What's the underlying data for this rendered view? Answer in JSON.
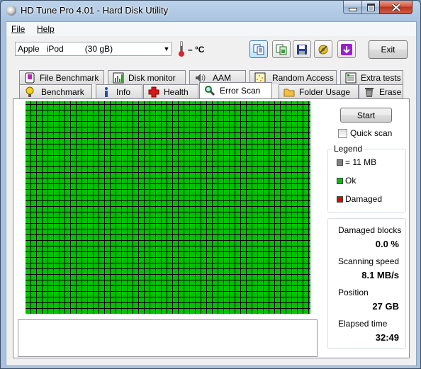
{
  "window": {
    "title": "HD Tune Pro 4.01 - Hard Disk Utility"
  },
  "menu": {
    "file_label": "File",
    "help_label": "Help"
  },
  "toolbar": {
    "device": "Apple   iPod         (30 gB)",
    "temperature": "– °C",
    "exit_label": "Exit",
    "buttons": [
      "copy-text-icon",
      "copy-screenshot-icon",
      "save-icon",
      "options-icon",
      "download-icon"
    ]
  },
  "tabs": {
    "row1": [
      {
        "label": "File Benchmark",
        "icon": "file-benchmark-icon"
      },
      {
        "label": "Disk monitor",
        "icon": "disk-monitor-icon"
      },
      {
        "label": "AAM",
        "icon": "speaker-icon"
      },
      {
        "label": "Random Access",
        "icon": "random-access-icon"
      },
      {
        "label": "Extra tests",
        "icon": "extra-tests-icon"
      }
    ],
    "row2": [
      {
        "label": "Benchmark",
        "icon": "benchmark-icon"
      },
      {
        "label": "Info",
        "icon": "info-icon"
      },
      {
        "label": "Health",
        "icon": "health-icon"
      },
      {
        "label": "Error Scan",
        "icon": "magnifier-icon",
        "selected": true
      },
      {
        "label": "Folder Usage",
        "icon": "folder-icon"
      },
      {
        "label": "Erase",
        "icon": "trash-icon"
      }
    ]
  },
  "scan": {
    "start_label": "Start",
    "quick_scan_label": "Quick scan",
    "quick_scan_checked": false,
    "block_colors": {
      "ok": "#00c000",
      "grid_line": "#000000"
    }
  },
  "legend": {
    "title": "Legend",
    "items": [
      {
        "label": "= 11 MB",
        "color": "#808080"
      },
      {
        "label": "Ok",
        "color": "#00c000"
      },
      {
        "label": "Damaged",
        "color": "#e00000"
      }
    ]
  },
  "stats": {
    "damaged_blocks_label": "Damaged blocks",
    "damaged_blocks_value": "0.0 %",
    "scanning_speed_label": "Scanning speed",
    "scanning_speed_value": "8.1 MB/s",
    "position_label": "Position",
    "position_value": "27 GB",
    "elapsed_label": "Elapsed time",
    "elapsed_value": "32:49"
  }
}
